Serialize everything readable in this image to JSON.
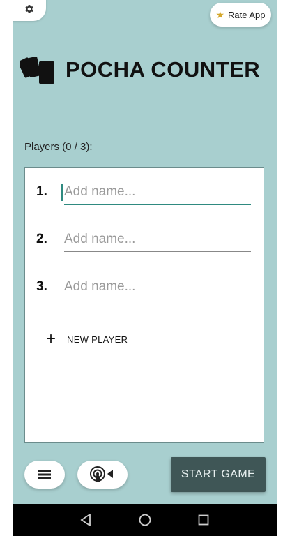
{
  "header": {
    "settings_icon": "gear-icon",
    "rate_app_label": "Rate App",
    "rate_app_icon": "star-icon",
    "title": "POCHA COUNTER",
    "logo_icon": "cards-icon"
  },
  "players": {
    "count_label": "Players (0 / 3):",
    "rows": [
      {
        "number": "1.",
        "value": "",
        "placeholder": "Add name...",
        "focused": true
      },
      {
        "number": "2.",
        "value": "",
        "placeholder": "Add name...",
        "focused": false
      },
      {
        "number": "3.",
        "value": "",
        "placeholder": "Add name...",
        "focused": false
      }
    ],
    "new_player_label": "NEW PLAYER",
    "new_player_icon": "plus-icon"
  },
  "footer": {
    "menu_icon": "menu-icon",
    "broadcast_icon": "broadcast-icon",
    "start_game_label": "START GAME"
  },
  "navigation": {
    "back_icon": "back-icon",
    "home_icon": "home-icon",
    "recents_icon": "recents-icon"
  },
  "colors": {
    "background": "#a8cfcf",
    "accent": "#2f8a80",
    "start_button": "#3f5656",
    "star": "#d4a72c"
  }
}
